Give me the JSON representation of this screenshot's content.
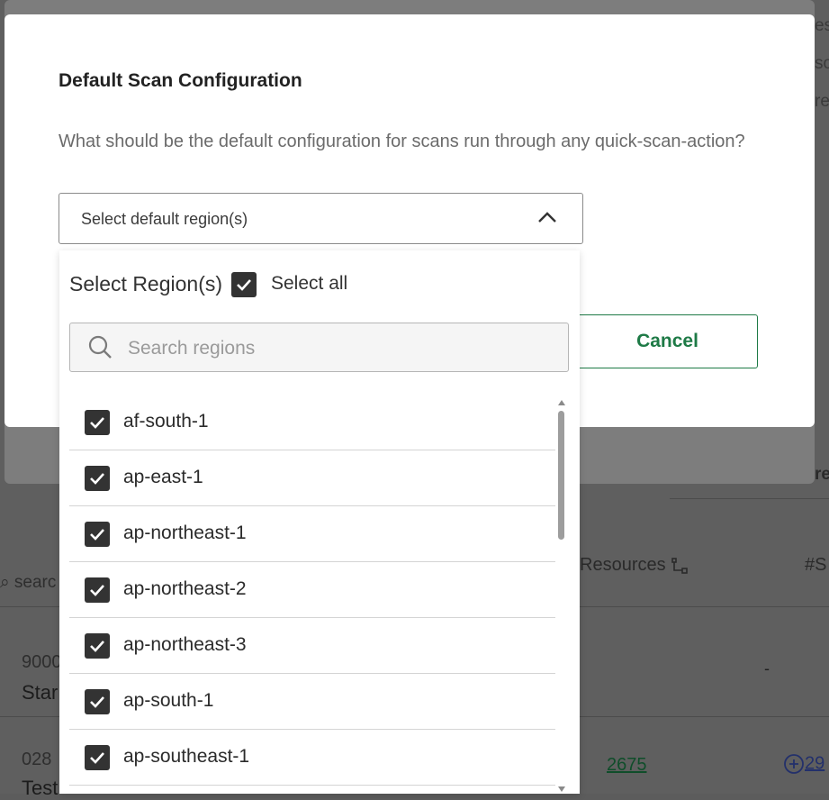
{
  "modal": {
    "title": "Default Scan Configuration",
    "question": "What should be the default configuration for scans run through any quick-scan-action?",
    "region_select_placeholder": "Select default region(s)",
    "cancel_label": "Cancel"
  },
  "dropdown": {
    "title": "Select Region(s)",
    "select_all_label": "Select all",
    "select_all_checked": true,
    "search_placeholder": "Search regions",
    "regions": [
      {
        "label": "af-south-1",
        "checked": true
      },
      {
        "label": "ap-east-1",
        "checked": true
      },
      {
        "label": "ap-northeast-1",
        "checked": true
      },
      {
        "label": "ap-northeast-2",
        "checked": true
      },
      {
        "label": "ap-northeast-3",
        "checked": true
      },
      {
        "label": "ap-south-1",
        "checked": true
      },
      {
        "label": "ap-southeast-1",
        "checked": true
      }
    ]
  },
  "background": {
    "edge_fragments": [
      "es",
      "so",
      "re",
      "re"
    ],
    "column_resources": "Resources",
    "column_hash": "#S",
    "search_fragment": "searc",
    "dash_value": "-",
    "rows": [
      {
        "num": "9000",
        "name": "Star"
      },
      {
        "num": "028",
        "name": "Test"
      }
    ],
    "resource_count": "2675",
    "plus_fragment": "29"
  },
  "colors": {
    "accent_green": "#1e7a46",
    "checkbox_fill": "#333333",
    "overlay": "#5f5f5f"
  }
}
